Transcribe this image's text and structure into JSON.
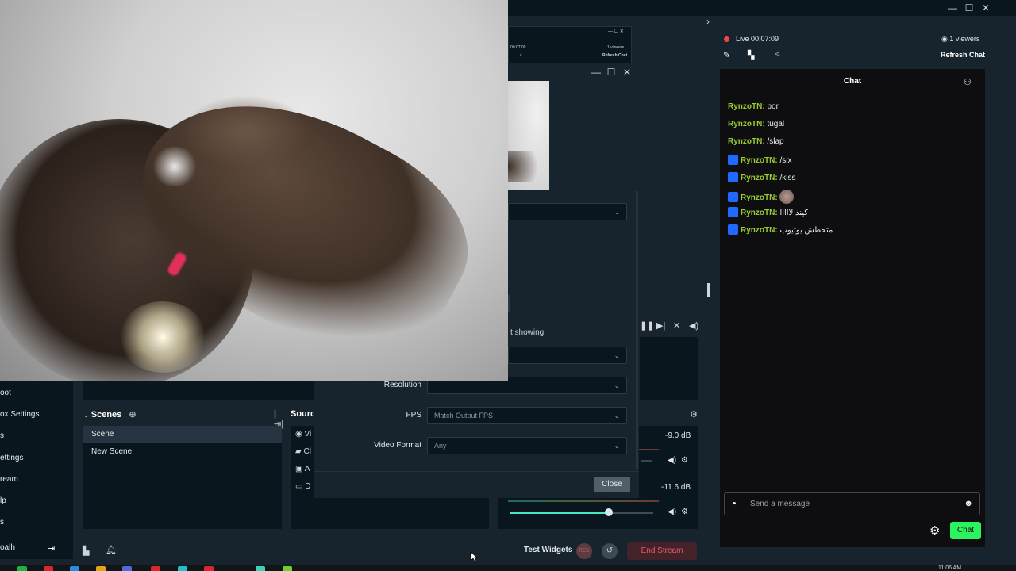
{
  "window": {
    "minimize": "—",
    "maximize": "☐",
    "close": "✕"
  },
  "nav": {
    "items": [
      "oot",
      "ox Settings",
      "s",
      "ettings",
      "ream",
      "lp",
      "s",
      "oalh"
    ]
  },
  "scenes": {
    "title": "Scenes",
    "items": [
      {
        "label": "Scene",
        "active": true
      },
      {
        "label": "New Scene",
        "active": false
      }
    ]
  },
  "sources": {
    "title": "Sourc",
    "items": [
      "Vi",
      "Cl",
      "A",
      "D"
    ]
  },
  "mixer": {
    "levels": [
      "-9.0 dB",
      "-11.6 dB"
    ],
    "slider_fraction": 0.69
  },
  "dialog": {
    "showing_text": "t showing",
    "fields": [
      {
        "label": "Resolution",
        "value": ""
      },
      {
        "label": "FPS",
        "value": "Match Output FPS"
      },
      {
        "label": "Video Format",
        "value": "Any"
      }
    ],
    "close_label": "Close"
  },
  "footer": {
    "test_widgets": "Test Widgets",
    "rec_label": "REC",
    "end_stream": "End Stream"
  },
  "chat": {
    "live_label": "Live",
    "live_time": "00:07:09",
    "viewers": "1 viewers",
    "refresh": "Refresh Chat",
    "title": "Chat",
    "messages": [
      {
        "user": "RynzoTN:",
        "text": "por",
        "badge": false
      },
      {
        "user": "RynzoTN:",
        "text": "tugal",
        "badge": false
      },
      {
        "user": "RynzoTN:",
        "text": "/slap",
        "badge": false
      },
      {
        "user": "RynzoTN:",
        "text": "/six",
        "badge": true
      },
      {
        "user": "RynzoTN:",
        "text": "/kiss",
        "badge": true
      },
      {
        "user": "RynzoTN:",
        "text": "",
        "badge": true,
        "sticker": true
      },
      {
        "user": "RynzoTN:",
        "text": "كيند لااااا",
        "badge": true
      },
      {
        "user": "RynzoTN:",
        "text": "متحطش يوتيوب",
        "badge": true
      }
    ],
    "input_placeholder": "Send a message",
    "send_label": "Chat",
    "colors": {
      "username": "#9acd32",
      "send_button": "#2bf25f",
      "live_dot": "#f04848"
    }
  },
  "inner_window": {
    "time": "00:07:09",
    "viewers": "1 viewers",
    "refresh": "Refresh Chat"
  },
  "taskbar": {
    "clock": "11:06 AM"
  }
}
